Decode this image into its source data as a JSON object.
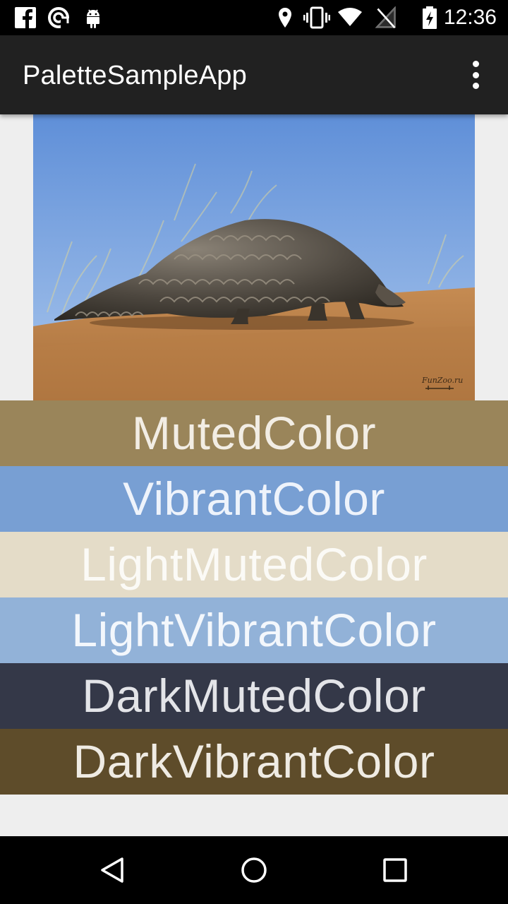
{
  "status_bar": {
    "time": "12:36",
    "left_icons": [
      "facebook-icon",
      "sync-icon",
      "android-icon"
    ],
    "right_icons": [
      "location-icon",
      "vibrate-icon",
      "wifi-icon",
      "no-signal-icon",
      "battery-charging-icon"
    ]
  },
  "app_bar": {
    "title": "PaletteSampleApp",
    "menu_icon": "more-vert-icon"
  },
  "image": {
    "watermark": "FunZoo.ru"
  },
  "swatches": [
    {
      "label": "MutedColor",
      "bg": "#9a855a",
      "fg": "#f2ede4"
    },
    {
      "label": "VibrantColor",
      "bg": "#789fd3",
      "fg": "#eef3fb"
    },
    {
      "label": "LightMutedColor",
      "bg": "#e4dcc8",
      "fg": "#fbfaf6"
    },
    {
      "label": "LightVibrantColor",
      "bg": "#92b2d8",
      "fg": "#f3f7fc"
    },
    {
      "label": "DarkMutedColor",
      "bg": "#343848",
      "fg": "#e3e4e8"
    },
    {
      "label": "DarkVibrantColor",
      "bg": "#5e4c2a",
      "fg": "#efebe3"
    }
  ],
  "nav_bar": {
    "buttons": [
      "back-icon",
      "home-icon",
      "recents-icon"
    ]
  }
}
